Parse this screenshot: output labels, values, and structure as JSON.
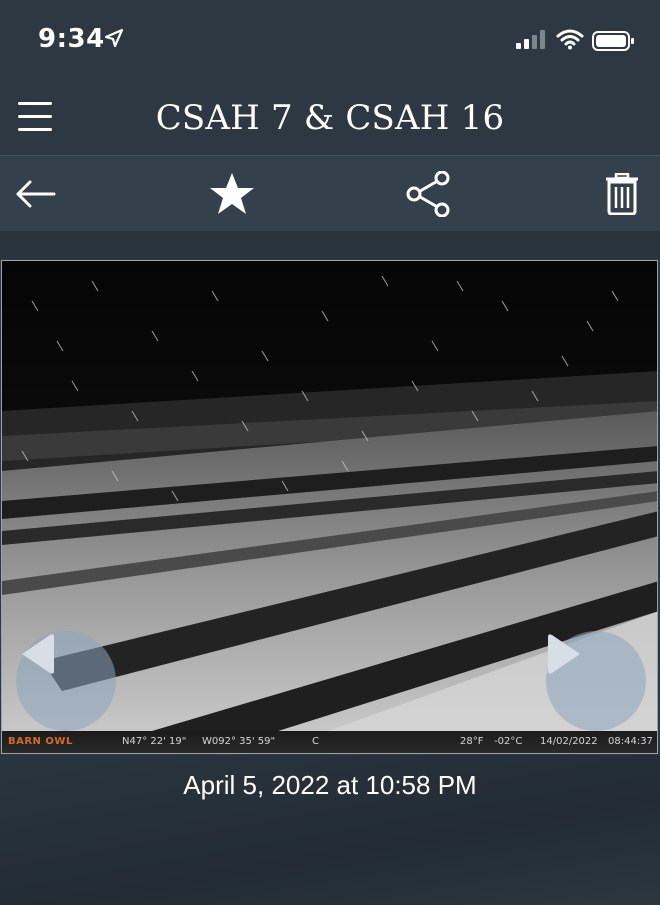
{
  "status_bar": {
    "time": "9:34",
    "icons": [
      "location-arrow-icon",
      "cellular-signal-icon",
      "wifi-icon",
      "battery-icon"
    ]
  },
  "header": {
    "title": "CSAH 7 & CSAH 16",
    "menu_icon": "hamburger-menu-icon"
  },
  "toolbar": {
    "icons": [
      "back-arrow-icon",
      "star-icon",
      "share-icon",
      "trash-icon"
    ]
  },
  "photo": {
    "description_icon": "camera-photo",
    "overlay": {
      "brand": "BARN OWL",
      "latitude": "N47° 22' 19\"",
      "longitude": "W092° 35' 59\"",
      "camera_id": "C",
      "temp_f": "28°F",
      "temp_c": "-02°C",
      "date": "14/02/2022",
      "time": "08:44:37"
    },
    "nav": {
      "prev_icon": "play-left-icon",
      "next_icon": "play-right-icon"
    }
  },
  "caption": "April 5, 2022 at 10:58 PM",
  "colors": {
    "background": "#2e3842",
    "toolbar": "#34404b",
    "brand_orange": "#d66a2a"
  }
}
